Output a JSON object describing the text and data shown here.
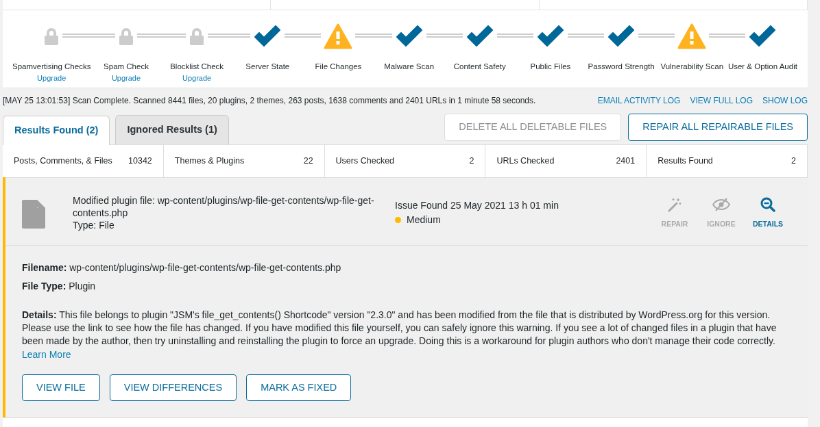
{
  "steps": [
    {
      "label": "Spamvertising Checks",
      "kind": "lock",
      "link": "Upgrade"
    },
    {
      "label": "Spam Check",
      "kind": "lock",
      "link": "Upgrade"
    },
    {
      "label": "Blocklist Check",
      "kind": "lock",
      "link": "Upgrade"
    },
    {
      "label": "Server State",
      "kind": "check"
    },
    {
      "label": "File Changes",
      "kind": "warning"
    },
    {
      "label": "Malware Scan",
      "kind": "check"
    },
    {
      "label": "Content Safety",
      "kind": "check"
    },
    {
      "label": "Public Files",
      "kind": "check"
    },
    {
      "label": "Password Strength",
      "kind": "check"
    },
    {
      "label": "Vulnerability Scan",
      "kind": "warning"
    },
    {
      "label": "User & Option Audit",
      "kind": "check"
    }
  ],
  "log": {
    "message": "[MAY 25 13:01:53] Scan Complete. Scanned 8441 files, 20 plugins, 2 themes, 263 posts, 1638 comments and 2401 URLs in 1 minute 58 seconds.",
    "links": [
      "EMAIL ACTIVITY LOG",
      "VIEW FULL LOG",
      "SHOW LOG"
    ]
  },
  "tabs": [
    {
      "label": "Results Found (2)",
      "selected": true
    },
    {
      "label": "Ignored Results (1)",
      "selected": false
    }
  ],
  "bulk_buttons": [
    {
      "label": "DELETE ALL DELETABLE FILES",
      "disabled": true
    },
    {
      "label": "REPAIR ALL REPAIRABLE FILES",
      "disabled": false
    }
  ],
  "stats": [
    {
      "label": "Posts, Comments, & Files",
      "value": "10342"
    },
    {
      "label": "Themes & Plugins",
      "value": "22"
    },
    {
      "label": "Users Checked",
      "value": "2"
    },
    {
      "label": "URLs Checked",
      "value": "2401"
    },
    {
      "label": "Results Found",
      "value": "2"
    }
  ],
  "issue": {
    "title": "Modified plugin file: wp-content/plugins/wp-file-get-contents/wp-file-get-contents.php",
    "type": "Type: File",
    "found": "Issue Found 25 May 2021 13 h 01 min",
    "severity": {
      "label": "Medium",
      "color": "#ffb900"
    },
    "actions": [
      {
        "label": "REPAIR",
        "kind": "wand",
        "disabled": true
      },
      {
        "label": "IGNORE",
        "kind": "eye",
        "disabled": true
      },
      {
        "label": "DETAILS",
        "kind": "zoom",
        "disabled": false
      }
    ],
    "details": [
      {
        "text": "**Filename:** wp-content/plugins/wp-file-get-contents/wp-file-get-contents.php"
      },
      {
        "text": "**File Type:** Plugin"
      },
      {
        "text": "**Details:** This file belongs to plugin \"JSM's file_get_contents() Shortcode\" version \"2.3.0\" and has been modified from the file that is distributed by WordPress.org for this version. Please use the link to see how the file has changed. If you have modified this file yourself, you can safely ignore this warning. If you see a lot of changed files in a plugin that have been made by the author, then try uninstalling and reinstalling the plugin to force an upgrade. Doing this is a workaround for plugin authors who don't manage their code correctly."
      }
    ],
    "learn_more": "Learn More",
    "buttons": [
      "VIEW FILE",
      "VIEW DIFFERENCES",
      "MARK AS FIXED"
    ]
  }
}
